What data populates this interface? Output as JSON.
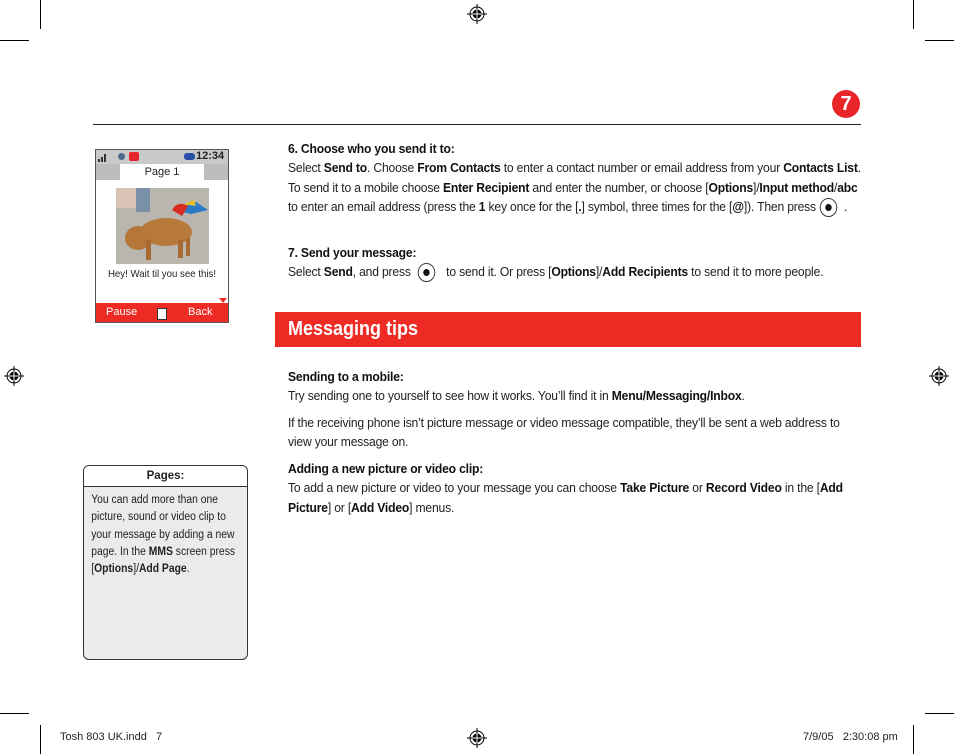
{
  "page": {
    "number": "7",
    "footer_left": "Tosh 803 UK.indd   7",
    "footer_right": "7/9/05   2:30:08 pm"
  },
  "phone_screen": {
    "time": "12:34",
    "tab_label": "Page 1",
    "caption": "Hey! Wait til you see this!",
    "softkey_left": "Pause",
    "softkey_right": "Back",
    "icons": [
      "signal-icon",
      "message-icon",
      "envelope-icon",
      "battery-icon",
      "pause-icon",
      "scroll-down-arrow-icon"
    ]
  },
  "steps": [
    {
      "heading": "6. Choose who you send it to:",
      "parts": {
        "a": "Select ",
        "b": "Send to",
        "c": ". Choose ",
        "d": "From Contacts",
        "e": " to enter a contact number or email address from your ",
        "f": "Contacts List",
        "g": ". To send it to a mobile choose ",
        "h": "Enter Recipient",
        "i": " and enter the number, or choose [",
        "j": "Options",
        "k": "]/",
        "l": "Input method",
        "m": "/",
        "n": "abc",
        "o": " to enter an email address (press the ",
        "p": "1",
        "q": " key once for the [",
        "r": ".",
        "s": "] symbol, three times for the [",
        "t": "@",
        "u": "]). Then press",
        "v": " ."
      }
    },
    {
      "heading": "7. Send your message:",
      "parts": {
        "a": "Select ",
        "b": "Send",
        "c": ", and press",
        "d": " to send it. Or press [",
        "e": "Options",
        "f": "]/",
        "g": "Add Recipients",
        "h": " to send it to more people."
      }
    }
  ],
  "section": {
    "title": "Messaging tips",
    "tip1": {
      "heading": "Sending to a mobile:",
      "a": "Try sending one to yourself to see how it works. You’ll find it in ",
      "b": "Menu/Messaging/Inbox",
      "c": "."
    },
    "tip2": {
      "text": "If the receiving phone isn’t picture message or video message compatible, they’ll be sent a web address to view your message on."
    },
    "tip3": {
      "heading": "Adding a new picture or video clip:",
      "a": "To add a new picture or video to your message you can choose ",
      "b": "Take Picture",
      "c": " or ",
      "d": "Record Video",
      "e": " in the [",
      "f": "Add Picture",
      "g": "] or [",
      "h": "Add Video",
      "i": "] menus."
    }
  },
  "sidebox": {
    "title": "Pages:",
    "a": "You can add more than one picture, sound or video clip to your message by adding a new page. In the ",
    "b": "MMS",
    "c": " screen press [",
    "d": "Options",
    "e": "]/",
    "f": "Add Page",
    "g": "."
  },
  "colors": {
    "accent_red": "#ee2a24"
  }
}
